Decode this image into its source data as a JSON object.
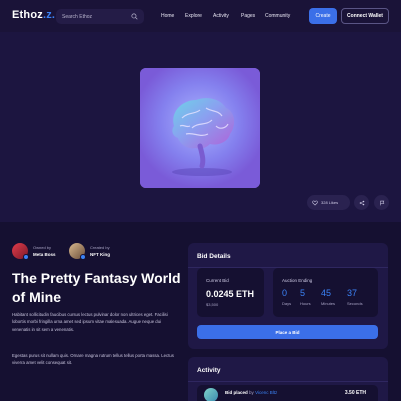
{
  "nav": {
    "logo_main": "Ethoz",
    "logo_dot": ".",
    "search_placeholder": "Search Ethoz",
    "menu": [
      "Home",
      "Explore",
      "Activity",
      "Pages",
      "Community"
    ],
    "create_label": "Create",
    "wallet_label": "Connect Wallet"
  },
  "hero": {
    "likes": "328 Likes"
  },
  "owner": {
    "label": "Owned by",
    "name": "Meta Boss"
  },
  "creator": {
    "label": "Created by",
    "name": "NFT King"
  },
  "title": "The Pretty Fantasy World of Mine",
  "paragraphs": [
    "Habitant sollicitudin faucibus cursus lectus pulvinar dolor non ultrices eget. Facilisi lobortis morbi fringilla urna amet sed ipsum vitae malesuada. Augue neque dui venenatis in sit sem a venenatis.",
    "Egestas purus sit nullam quis. Ornare magna rutrum tellus tellus porta massa. Lectus viverra amet velit consequat sit."
  ],
  "bid": {
    "heading": "Bid Details",
    "current_label": "Current Bid",
    "current_value": "0.0245 ETH",
    "current_usd": "$3,500",
    "auction_label": "Auction Ending",
    "countdown": [
      {
        "n": "0",
        "u": "Days"
      },
      {
        "n": "5",
        "u": "Hours"
      },
      {
        "n": "45",
        "u": "Minutes"
      },
      {
        "n": "37",
        "u": "Seconds"
      }
    ],
    "place_label": "Place a Bid"
  },
  "activity": {
    "heading": "Activity",
    "item_prefix": "Bid placed",
    "item_by": "by",
    "item_user": "Vicenc Bltz",
    "item_amount": "3.50 ETH"
  },
  "colors": {
    "accent": "#3b82f6",
    "button": "#3b6fe8",
    "background": "#151031",
    "panel": "#1f1846"
  }
}
